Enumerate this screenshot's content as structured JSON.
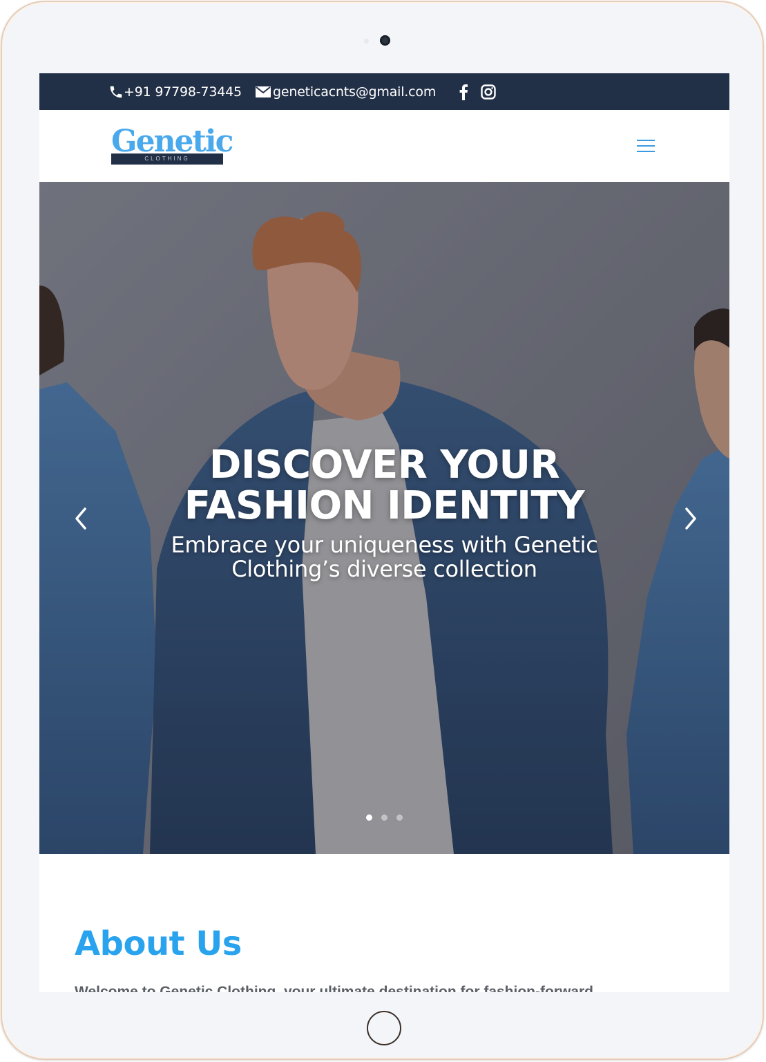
{
  "topbar": {
    "phone": "+91 97798-73445",
    "email": "geneticacnts@gmail.com",
    "social_icons": [
      "facebook-icon",
      "instagram-icon"
    ]
  },
  "header": {
    "logo_word": "Genetic",
    "logo_tagline": "CLOTHING",
    "menu_icon": "hamburger-icon"
  },
  "hero": {
    "title_line1": "DISCOVER YOUR",
    "title_line2": "FASHION IDENTITY",
    "subtitle_line1": "Embrace your uniqueness with Genetic",
    "subtitle_line2": "Clothing’s diverse collection",
    "slide_count": 3,
    "active_slide": 1
  },
  "about": {
    "title": "About Us",
    "intro": "Welcome to Genetic Clothing, your ultimate destination for fashion-forward"
  },
  "colors": {
    "topbar_bg": "#223047",
    "accent_blue": "#2aa3ee",
    "logo_blue": "#4aa9ec"
  }
}
